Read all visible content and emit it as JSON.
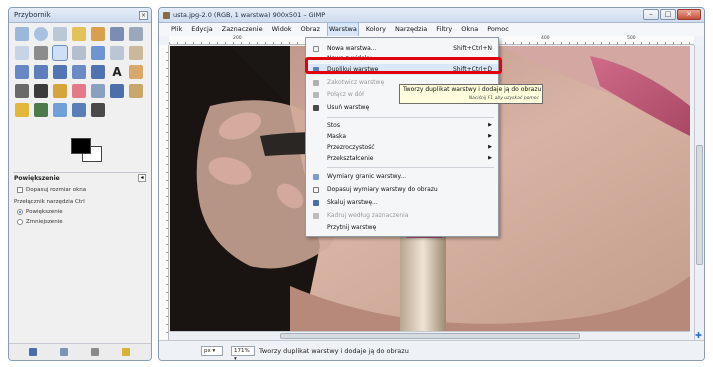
{
  "toolbox": {
    "title": "Przybornik",
    "options_title": "Powiększenie",
    "resize_window_label": "Dopasuj rozmiar okna",
    "toggle_label": "Przełącznik narzędzia  Ctrl",
    "zoom_in_label": "Powiększenie",
    "zoom_out_label": "Zmniejszenie"
  },
  "image_window": {
    "title": "usta.jpg-2.0 (RGB, 1 warstwa) 900x501 – GIMP",
    "menubar": [
      "Plik",
      "Edycja",
      "Zaznaczenie",
      "Widok",
      "Obraz",
      "Warstwa",
      "Kolory",
      "Narzędzia",
      "Filtry",
      "Okna",
      "Pomoc"
    ],
    "open_menu": "Warstwa",
    "ruler_labels": [
      "200",
      "400",
      "500"
    ],
    "status": {
      "unit": "px",
      "zoom": "171%",
      "message": "Tworzy duplikat warstwy i dodaje ją do obrazu"
    }
  },
  "layer_menu": {
    "items": [
      {
        "label": "Nowa warstwa...",
        "shortcut": "Shift+Ctrl+N",
        "icon": "new-layer-icon",
        "disabled": false
      },
      {
        "label": "Nowa z widoku",
        "shortcut": "",
        "icon": "",
        "disabled": false
      },
      {
        "label": "Duplikuj warstwę",
        "shortcut": "Shift+Ctrl+D",
        "icon": "duplicate-layer-icon",
        "disabled": false,
        "highlighted": true
      },
      {
        "label": "Zakotwicz warstwę",
        "shortcut": "",
        "icon": "anchor-icon",
        "disabled": true
      },
      {
        "label": "Połącz w dół",
        "shortcut": "",
        "icon": "merge-down-icon",
        "disabled": true
      },
      {
        "label": "Usuń warstwę",
        "shortcut": "",
        "icon": "delete-icon",
        "disabled": false
      },
      {
        "label": "Stos",
        "submenu": true
      },
      {
        "label": "Maska",
        "submenu": true
      },
      {
        "label": "Przezroczystość",
        "submenu": true
      },
      {
        "label": "Przekształcenie",
        "submenu": true
      },
      {
        "label": "Wymiary granic warstwy...",
        "icon": "layer-boundary-icon",
        "disabled": false
      },
      {
        "label": "Dopasuj wymiary warstwy do obrazu",
        "icon": "layer-to-image-size-icon",
        "disabled": false
      },
      {
        "label": "Skaluj warstwę...",
        "icon": "scale-layer-icon",
        "disabled": false
      },
      {
        "label": "Kadruj według zaznaczenia",
        "icon": "crop-icon",
        "disabled": true
      },
      {
        "label": "Przytnij warstwę",
        "icon": "",
        "disabled": false
      }
    ]
  },
  "tooltip": {
    "text": "Tworzy duplikat warstwy i dodaje ją do obrazu",
    "hint": "Naciśnij F1 aby uzyskać pomoc"
  },
  "colors": {
    "highlight_box": "#e2000f",
    "tooltip_bg": "#ffffdd",
    "lipstick": "#c0607e"
  }
}
